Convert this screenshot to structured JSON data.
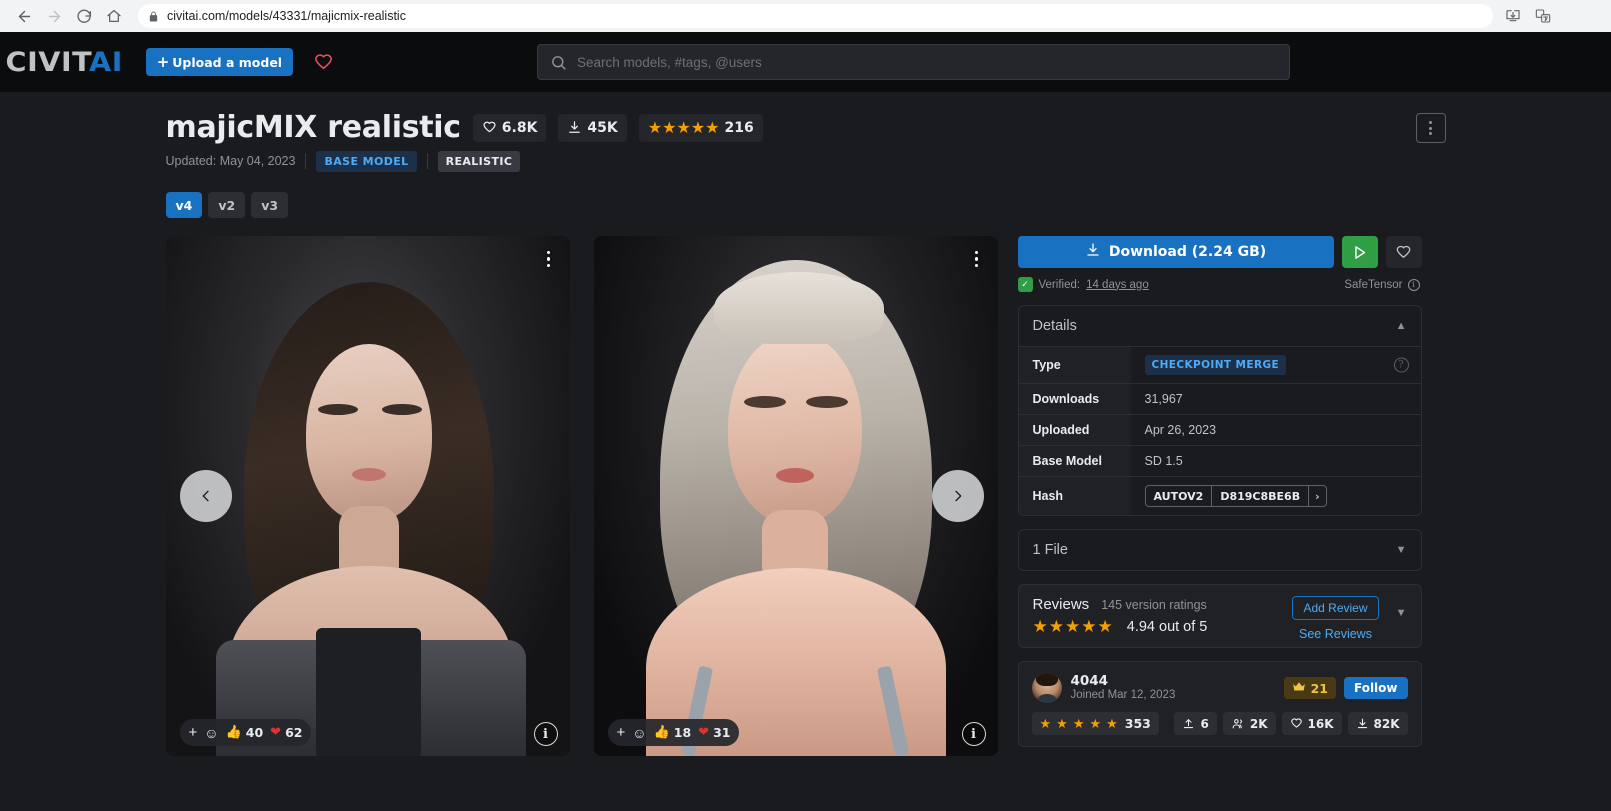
{
  "browser": {
    "url": "civitai.com/models/43331/majicmix-realistic",
    "back_icon": "back-arrow-icon",
    "forward_icon": "forward-arrow-icon",
    "reload_icon": "reload-icon",
    "home_icon": "home-icon",
    "lock_icon": "lock-icon",
    "install_icon": "install-app-icon",
    "translate_icon": "translate-icon"
  },
  "header": {
    "logo_part1": "CIVIT",
    "logo_part2": "AI",
    "upload_label": "Upload a model",
    "search_placeholder": "Search models, #tags, @users",
    "search_value": ""
  },
  "model": {
    "title": "majicMIX realistic",
    "likes": "6.8K",
    "downloads_short": "45K",
    "rating_count": "216",
    "star_count": 5,
    "updated": "Updated: May 04, 2023",
    "tag_base": "BASE MODEL",
    "tag_category": "REALISTIC",
    "versions": [
      {
        "label": "v4",
        "active": true
      },
      {
        "label": "v2",
        "active": false
      },
      {
        "label": "v3",
        "active": false
      }
    ]
  },
  "gallery": [
    {
      "kebab": "image-options-icon",
      "add_reaction": "+",
      "smiley": "☺",
      "thumbs_up": "40",
      "hearts": "62",
      "info": "i"
    },
    {
      "kebab": "image-options-icon",
      "add_reaction": "+",
      "smiley": "☺",
      "thumbs_up": "18",
      "hearts": "31",
      "info": "i"
    }
  ],
  "sidebar": {
    "download_label": "Download (2.24 GB)",
    "run_icon": "play-icon",
    "favorite_icon": "heart-outline-icon",
    "verified_prefix": "Verified:",
    "verified_time": "14 days ago",
    "safetensor_label": "SafeTensor",
    "details": {
      "heading": "Details",
      "rows": [
        {
          "key": "Type",
          "value": "CHECKPOINT MERGE",
          "is_chip": true,
          "has_help": true
        },
        {
          "key": "Downloads",
          "value": "31,967",
          "is_chip": false,
          "has_help": false
        },
        {
          "key": "Uploaded",
          "value": "Apr 26, 2023",
          "is_chip": false,
          "has_help": false
        },
        {
          "key": "Base Model",
          "value": "SD 1.5",
          "is_chip": false,
          "has_help": false
        }
      ],
      "hash_key": "Hash",
      "hash_algo": "AUTOV2",
      "hash_value": "D819C8BE6B"
    },
    "files": {
      "heading": "1 File"
    },
    "reviews": {
      "title": "Reviews",
      "subtitle": "145 version ratings",
      "score": "4.94 out of 5",
      "stars": 5,
      "add_review": "Add Review",
      "see_reviews": "See Reviews"
    },
    "creator": {
      "name": "4044",
      "joined": "Joined Mar 12, 2023",
      "crown_count": "21",
      "follow_label": "Follow",
      "rating_count": "353",
      "rating_stars": 5,
      "stats": [
        {
          "icon": "upload-icon",
          "value": "6"
        },
        {
          "icon": "followers-icon",
          "value": "2K"
        },
        {
          "icon": "heart-icon",
          "value": "16K"
        },
        {
          "icon": "download-icon",
          "value": "82K"
        }
      ]
    }
  },
  "colors": {
    "accent_blue": "#1971c2",
    "link_blue": "#4dabf7",
    "star_orange": "#f59f00",
    "green": "#2f9e44",
    "heart_red": "#e64f5f",
    "bg": "#1a1b1e",
    "panel": "#202124"
  }
}
